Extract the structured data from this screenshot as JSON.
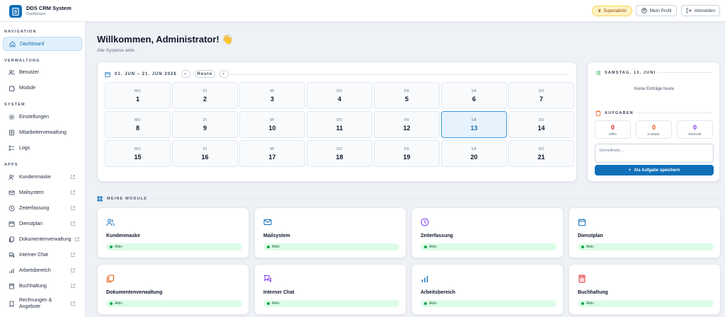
{
  "app": {
    "title": "DDS CRM System",
    "subtitle": "Dashboard"
  },
  "topbar": {
    "role_badge": "Superadmin",
    "profile_label": "Mein Profil",
    "logout_label": "Abmelden"
  },
  "sidebar": {
    "sections": {
      "navigation": "NAVIGATION",
      "verwaltung": "VERWALTUNG",
      "system": "SYSTEM",
      "apps": "APPS"
    },
    "items": [
      {
        "label": "Dashboard",
        "icon": "home-icon"
      },
      {
        "label": "Benutzer",
        "icon": "users-icon"
      },
      {
        "label": "Module",
        "icon": "puzzle-icon"
      },
      {
        "label": "Einstellungen",
        "icon": "gear-icon"
      },
      {
        "label": "Mitarbeiterverwaltung",
        "icon": "id-card-icon"
      },
      {
        "label": "Logs",
        "icon": "logs-icon"
      },
      {
        "label": "Kundenmaske",
        "icon": "users-icon"
      },
      {
        "label": "Mailsystem",
        "icon": "mail-icon"
      },
      {
        "label": "Zeiterfassung",
        "icon": "clock-icon"
      },
      {
        "label": "Dienstplan",
        "icon": "calendar-icon"
      },
      {
        "label": "Dokumentenverwaltung",
        "icon": "documents-icon"
      },
      {
        "label": "Interner Chat",
        "icon": "chat-icon"
      },
      {
        "label": "Arbeitsbereich",
        "icon": "chart-icon"
      },
      {
        "label": "Buchhaltung",
        "icon": "calculator-icon"
      },
      {
        "label": "Rechnungen &",
        "label2": "Angebote",
        "icon": "invoice-icon"
      }
    ]
  },
  "main": {
    "welcome": "Willkommen, Administrator! 👋",
    "status": "Alle Systeme aktiv"
  },
  "calendar": {
    "range": "01. JUN – 21. JUN 2026",
    "prev": "‹",
    "next": "›",
    "today_label": "Heute",
    "weekdays": [
      "MO",
      "DI",
      "MI",
      "DO",
      "FR",
      "SA",
      "SO"
    ],
    "weeks": [
      [
        "1",
        "2",
        "3",
        "4",
        "5",
        "6",
        "7"
      ],
      [
        "8",
        "9",
        "10",
        "11",
        "12",
        "13",
        "14"
      ],
      [
        "15",
        "16",
        "17",
        "18",
        "19",
        "20",
        "21"
      ]
    ],
    "today": "13"
  },
  "day_panel": {
    "heading": "SAMSTAG, 13. JUNI",
    "empty": "Keine Einträge heute",
    "tasks_heading": "AUFGABEN",
    "stats": [
      {
        "value": "0",
        "label": "Offen",
        "color": "#dc2626"
      },
      {
        "value": "0",
        "label": "In Bearb.",
        "color": "#ea580c"
      },
      {
        "value": "0",
        "label": "Rückrufe",
        "color": "#7c3aed"
      }
    ],
    "note_placeholder": "Schnellnotiz...",
    "save_label": "Als Aufgabe speichern"
  },
  "modules": {
    "heading": "MEINE MODULE",
    "items": [
      {
        "name": "Kundenmaske",
        "status": "Aktiv",
        "icon": "users-icon",
        "color": "#0f6fb8"
      },
      {
        "name": "Mailsystem",
        "status": "Aktiv",
        "icon": "mail-icon",
        "color": "#0f6fb8"
      },
      {
        "name": "Zeiterfassung",
        "status": "Aktiv",
        "icon": "clock-icon",
        "color": "#7c3aed"
      },
      {
        "name": "Dienstplan",
        "status": "Aktiv",
        "icon": "calendar-icon",
        "color": "#0f6fb8"
      },
      {
        "name": "Dokumentenverwaltung",
        "status": "Aktiv",
        "icon": "documents-icon",
        "color": "#ea580c"
      },
      {
        "name": "Interner Chat",
        "status": "Aktiv",
        "icon": "chat-icon",
        "color": "#7c3aed"
      },
      {
        "name": "Arbeitsbereich",
        "status": "Aktiv",
        "icon": "chart-icon",
        "color": "#0f6fb8"
      },
      {
        "name": "Buchhaltung",
        "status": "Aktiv",
        "icon": "calculator-icon",
        "color": "#dc2626"
      }
    ]
  }
}
